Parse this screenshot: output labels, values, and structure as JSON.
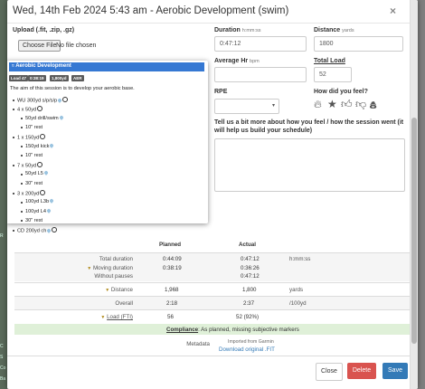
{
  "background": {
    "sidebar_fragments": [
      "R",
      "C",
      "S",
      "Co",
      "Ba"
    ]
  },
  "modal": {
    "title": "Wed, 14th Feb 2024 5:43 am - Aerobic Development (swim)",
    "close_symbol": "×"
  },
  "upload": {
    "label": "Upload (.fit, .zip, .gz)",
    "button": "Choose File",
    "status": "No file chosen"
  },
  "fields": {
    "duration": {
      "label": "Duration",
      "unit": "h:mm:ss",
      "value": "0:47:12"
    },
    "distance": {
      "label": "Distance",
      "unit": "yards",
      "value": "1800"
    },
    "avg_hr": {
      "label": "Average Hr",
      "unit": "bpm",
      "value": ""
    },
    "total_load": {
      "label": "Total Load",
      "value": "52"
    },
    "rpe": {
      "label": "RPE",
      "value": ""
    },
    "feel": {
      "label": "How did you feel?",
      "icons": [
        "flame-icon",
        "star-icon",
        "thumbs-up-icon",
        "thumbs-down-icon",
        "poop-icon"
      ]
    },
    "tell": {
      "label": "Tell us a bit more about how you feel / how the session went (it will help us build your schedule)",
      "value": ""
    }
  },
  "popup": {
    "title": "Aerobic Development",
    "badges": [
      "Load 47",
      "0:38:19",
      "1,800yd",
      "AER"
    ],
    "description": "The aim of this session is to develop your aerobic base.",
    "lines": [
      {
        "text": "WU 300yd s/p/s/p",
        "level": 0,
        "icons": [
          "drop",
          "clock"
        ]
      },
      {
        "text": "4 x 50yd",
        "level": 0,
        "icons": [
          "clock"
        ]
      },
      {
        "text": "50yd drill/swim",
        "level": 1,
        "icons": [
          "drop"
        ]
      },
      {
        "text": "10\" rest",
        "level": 1,
        "icons": []
      },
      {
        "text": "1 x 150yd",
        "level": 0,
        "icons": [
          "clock"
        ]
      },
      {
        "text": "150yd kick",
        "level": 1,
        "icons": [
          "drop"
        ]
      },
      {
        "text": "10\" rest",
        "level": 1,
        "icons": []
      },
      {
        "text": "7 x 50yd",
        "level": 0,
        "icons": [
          "clock"
        ]
      },
      {
        "text": "50yd L5",
        "level": 1,
        "icons": [
          "drop"
        ]
      },
      {
        "text": "30\" rest",
        "level": 1,
        "icons": []
      },
      {
        "text": "3 x 200yd",
        "level": 0,
        "icons": [
          "clock"
        ]
      },
      {
        "text": "100yd L3b",
        "level": 1,
        "icons": [
          "drop"
        ]
      },
      {
        "text": "100yd L4",
        "level": 1,
        "icons": [
          "drop"
        ]
      },
      {
        "text": "30\" rest",
        "level": 1,
        "icons": []
      },
      {
        "text": "CD 200yd ch",
        "level": 0,
        "icons": [
          "drop",
          "clock"
        ]
      }
    ]
  },
  "table": {
    "headers": {
      "planned": "Planned",
      "actual": "Actual"
    },
    "rows": {
      "total_duration": {
        "label": "Total duration",
        "planned": "0:44:09",
        "actual": "0:47:12",
        "unit": "h:mm:ss"
      },
      "moving_duration": {
        "label": "Moving duration",
        "planned": "0:38:19",
        "actual": "0:36:26"
      },
      "without_pauses": {
        "label": "Without pauses",
        "actual": "0:47:12"
      },
      "distance": {
        "label": "Distance",
        "planned": "1,968",
        "actual": "1,800",
        "unit": "yards"
      },
      "overall": {
        "label": "Overall",
        "planned": "2:18",
        "actual": "2:37",
        "unit": "/100yd"
      },
      "load": {
        "label": "Load (FTI)",
        "planned": "56",
        "actual": "52 (92%)"
      }
    },
    "compliance": {
      "label": "Compliance",
      "text": ": As planned, missing subjective markers"
    },
    "metadata": {
      "label": "Metadata",
      "source": "Imported from Garmin",
      "link": "Download original .FIT"
    }
  },
  "buttons": {
    "close": "Close",
    "delete": "Delete",
    "save": "Save"
  },
  "colors": {
    "primary": "#337ab7",
    "danger": "#d9534f",
    "popup_header": "#3578d3",
    "success_bg": "#dff0d8"
  }
}
